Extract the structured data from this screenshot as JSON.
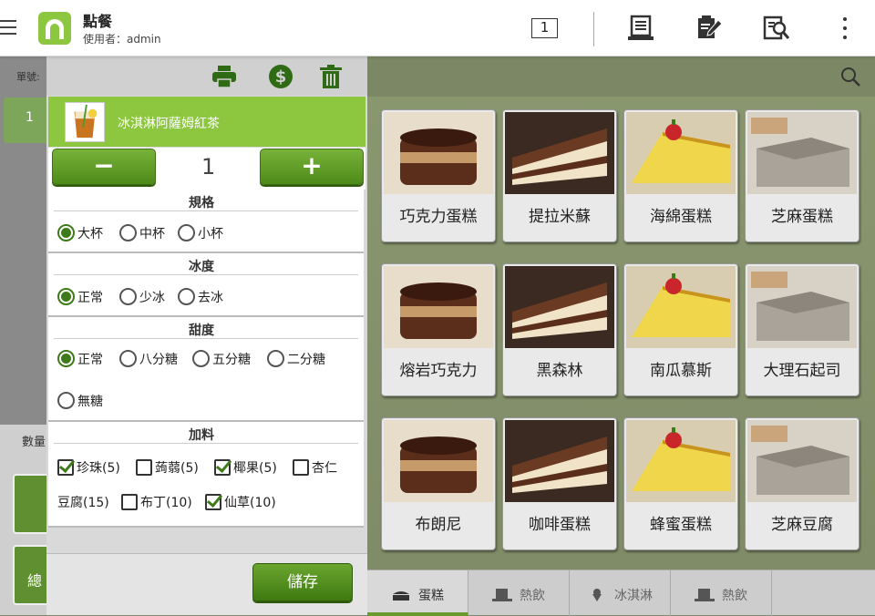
{
  "topbar": {
    "title": "點餐",
    "user": "使用者：admin",
    "table_no": "1"
  },
  "left_strip": {
    "order_label": "單號:",
    "order_value": "1",
    "qty_label": "數量",
    "total_label": "總"
  },
  "detail": {
    "item_name": "冰淇淋阿薩姆紅茶",
    "quantity": "1",
    "minus": "−",
    "plus": "+",
    "size": {
      "title": "規格",
      "options": [
        "大杯",
        "中杯",
        "小杯"
      ]
    },
    "ice": {
      "title": "冰度",
      "options": [
        "正常",
        "少冰",
        "去冰"
      ]
    },
    "sugar": {
      "title": "甜度",
      "options": [
        "正常",
        "八分糖",
        "五分糖",
        "二分糖",
        "無糖"
      ]
    },
    "toppings": {
      "title": "加料",
      "options": [
        "珍珠(5)",
        "蒟蒻(5)",
        "椰果(5)",
        "杏仁豆腐(15)",
        "布丁(10)",
        "仙草(10)"
      ],
      "almond_part1": "杏仁",
      "almond_part2": "豆腐(15)"
    },
    "save_label": "儲存"
  },
  "menu": {
    "items": [
      "巧克力蛋糕",
      "提拉米蘇",
      "海綿蛋糕",
      "芝麻蛋糕",
      "熔岩巧克力",
      "黑森林",
      "南瓜慕斯",
      "大理石起司",
      "布朗尼",
      "咖啡蛋糕",
      "蜂蜜蛋糕",
      "芝麻豆腐"
    ],
    "tabs": [
      "蛋糕",
      "熱飲",
      "冰淇淋",
      "熱飲"
    ]
  },
  "colors": {
    "accent": "#8dc63f",
    "button_green": "#4e8a18",
    "menu_bg": "#7f8a66"
  },
  "icons": [
    "menu-icon",
    "table-icon",
    "receipt-icon",
    "edit-icon",
    "search-list-icon",
    "more-icon",
    "printer-icon",
    "dollar-icon",
    "trash-icon",
    "search-icon"
  ]
}
